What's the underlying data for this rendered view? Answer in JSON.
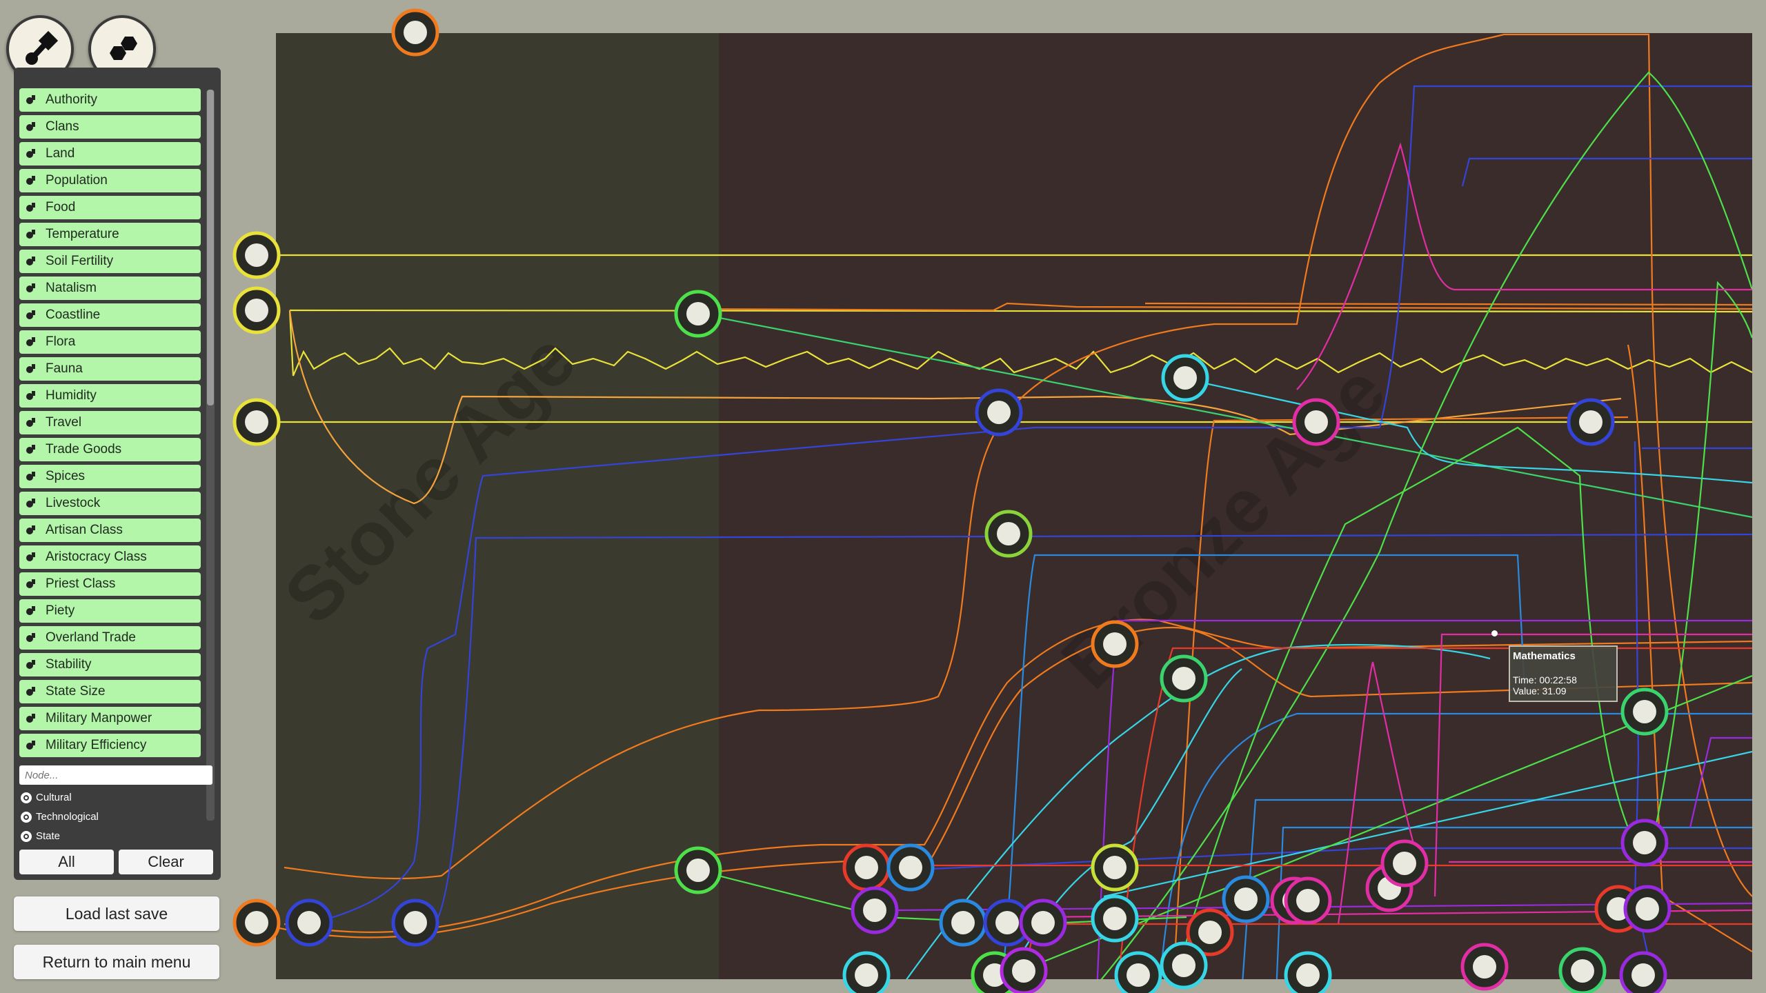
{
  "top_buttons": [
    {
      "name": "linked-nodes-button",
      "icon": "linked-nodes-icon"
    },
    {
      "name": "hex-nodes-button",
      "icon": "hexagon-cluster-icon"
    }
  ],
  "sidebar": {
    "items": [
      {
        "label": "Authority",
        "icon": "scepter-icon"
      },
      {
        "label": "Clans",
        "icon": "clans-icon"
      },
      {
        "label": "Land",
        "icon": "land-icon"
      },
      {
        "label": "Population",
        "icon": "people-icon"
      },
      {
        "label": "Food",
        "icon": "food-icon"
      },
      {
        "label": "Temperature",
        "icon": "temperature-icon"
      },
      {
        "label": "Soil Fertility",
        "icon": "soil-icon"
      },
      {
        "label": "Natalism",
        "icon": "mother-icon"
      },
      {
        "label": "Coastline",
        "icon": "coastline-icon"
      },
      {
        "label": "Flora",
        "icon": "flora-icon"
      },
      {
        "label": "Fauna",
        "icon": "fauna-icon"
      },
      {
        "label": "Humidity",
        "icon": "humidity-icon"
      },
      {
        "label": "Travel",
        "icon": "travel-icon"
      },
      {
        "label": "Trade Goods",
        "icon": "trade-goods-icon"
      },
      {
        "label": "Spices",
        "icon": "spices-icon"
      },
      {
        "label": "Livestock",
        "icon": "livestock-icon"
      },
      {
        "label": "Artisan Class",
        "icon": "artisan-icon"
      },
      {
        "label": "Aristocracy Class",
        "icon": "aristocracy-icon"
      },
      {
        "label": "Priest Class",
        "icon": "priest-icon"
      },
      {
        "label": "Piety",
        "icon": "piety-icon"
      },
      {
        "label": "Overland Trade",
        "icon": "overland-trade-icon"
      },
      {
        "label": "Stability",
        "icon": "stability-icon"
      },
      {
        "label": "State Size",
        "icon": "state-size-icon"
      },
      {
        "label": "Military Manpower",
        "icon": "manpower-icon"
      },
      {
        "label": "Military Efficiency",
        "icon": "efficiency-icon"
      }
    ],
    "node_placeholder": "Node...",
    "filters": [
      "Cultural",
      "Technological",
      "State"
    ],
    "all_label": "All",
    "clear_label": "Clear"
  },
  "actions": {
    "load_label": "Load last save",
    "menu_label": "Return to main menu"
  },
  "graph": {
    "eras": [
      "Stone Age",
      "Bronze Age"
    ],
    "colors": {
      "stone_age_bg": "#3a3a2e",
      "bronze_age_bg": "#3a2c2b",
      "yellow": "#e8e23a",
      "orange": "#f07a1e",
      "blue": "#3544d8",
      "green": "#4ee04a",
      "cyan": "#37d6e6",
      "magenta": "#e22ea4",
      "red": "#e83a2a",
      "purple": "#9a2ae0"
    }
  },
  "tooltip": {
    "title": "Mathematics",
    "time": "Time: 00:22:58",
    "value": "Value: 31.09"
  }
}
